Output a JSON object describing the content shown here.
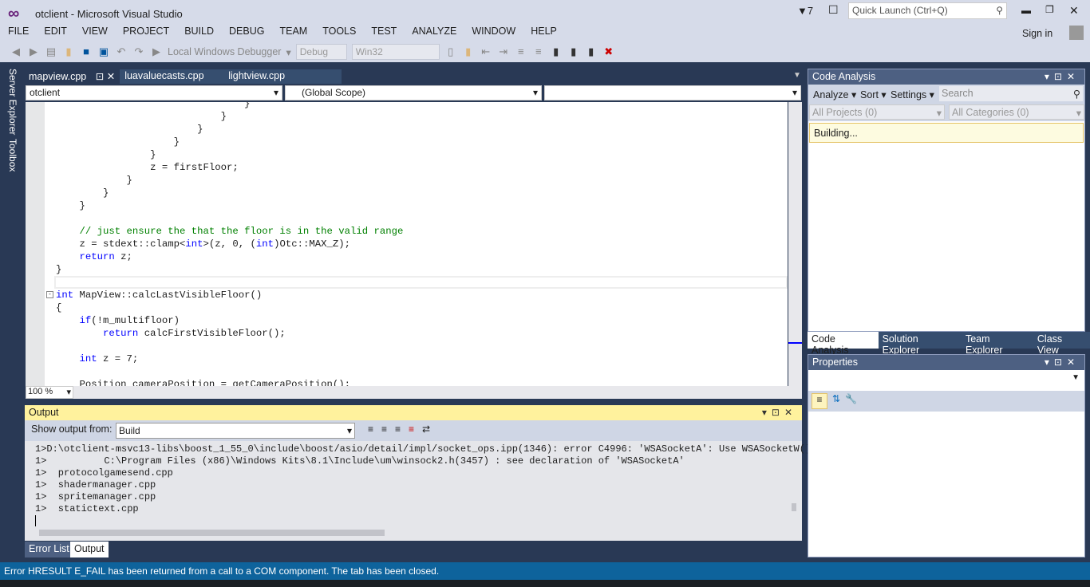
{
  "window": {
    "title": "otclient - Microsoft Visual Studio",
    "notifications": "7",
    "quick_launch_placeholder": "Quick Launch (Ctrl+Q)",
    "sign_in": "Sign in"
  },
  "menu": [
    "FILE",
    "EDIT",
    "VIEW",
    "PROJECT",
    "BUILD",
    "DEBUG",
    "TEAM",
    "TOOLS",
    "TEST",
    "ANALYZE",
    "WINDOW",
    "HELP"
  ],
  "toolbar": {
    "debugger": "Local Windows Debugger",
    "config": "Debug",
    "platform": "Win32"
  },
  "side_tabs": [
    "Server Explorer",
    "Toolbox"
  ],
  "doc_tabs": [
    "mapview.cpp",
    "luavaluecasts.cpp",
    "lightview.cpp"
  ],
  "nav": {
    "project": "otclient",
    "scope": "(Global Scope)",
    "member": ""
  },
  "zoom": "100 %",
  "code": [
    [
      [
        "",
        "                                }"
      ]
    ],
    [
      [
        "",
        "                            }"
      ]
    ],
    [
      [
        "",
        "                        }"
      ]
    ],
    [
      [
        "",
        "                    }"
      ]
    ],
    [
      [
        "",
        "                }"
      ]
    ],
    [
      [
        "",
        "                z = firstFloor;"
      ]
    ],
    [
      [
        "",
        "            }"
      ]
    ],
    [
      [
        "",
        "        }"
      ]
    ],
    [
      [
        "",
        "    }"
      ]
    ],
    [
      [
        "",
        ""
      ]
    ],
    [
      [
        "c",
        "    // just ensure the that the floor is in the valid range"
      ]
    ],
    [
      [
        "",
        "    z = stdext::clamp<"
      ],
      [
        "k",
        "int"
      ],
      [
        "",
        ">(z, 0, ("
      ],
      [
        "k",
        "int"
      ],
      [
        "",
        ")Otc::MAX_Z);"
      ]
    ],
    [
      [
        "k",
        "    return"
      ],
      [
        "",
        " z;"
      ]
    ],
    [
      [
        "",
        "}"
      ]
    ],
    [
      [
        "",
        ""
      ]
    ],
    [
      [
        "k",
        "int"
      ],
      [
        "",
        " MapView::calcLastVisibleFloor()"
      ]
    ],
    [
      [
        "",
        "{"
      ]
    ],
    [
      [
        "k",
        "    if"
      ],
      [
        "",
        "(!m_multifloor)"
      ]
    ],
    [
      [
        "k",
        "        return"
      ],
      [
        "",
        " calcFirstVisibleFloor();"
      ]
    ],
    [
      [
        "",
        ""
      ]
    ],
    [
      [
        "k",
        "    int"
      ],
      [
        "",
        " z = 7;"
      ]
    ],
    [
      [
        "",
        ""
      ]
    ],
    [
      [
        "",
        "    Position cameraPosition = getCameraPosition();"
      ]
    ]
  ],
  "code_analysis": {
    "title": "Code Analysis",
    "analyze": "Analyze",
    "sort": "Sort",
    "settings": "Settings",
    "search_placeholder": "Search",
    "projects": "All Projects (0)",
    "categories": "All Categories (0)",
    "status": "Building..."
  },
  "right_tabs": [
    "Code Analysis",
    "Solution Explorer",
    "Team Explorer",
    "Class View"
  ],
  "properties": {
    "title": "Properties"
  },
  "output": {
    "title": "Output",
    "show_from_label": "Show output from:",
    "source": "Build",
    "lines": [
      "1>D:\\otclient-msvc13-libs\\boost_1_55_0\\include\\boost/asio/detail/impl/socket_ops.ipp(1346): error C4996: 'WSASocketA': Use WSASocketW()",
      "1>          C:\\Program Files (x86)\\Windows Kits\\8.1\\Include\\um\\winsock2.h(3457) : see declaration of 'WSASocketA'",
      "1>  protocolgamesend.cpp",
      "1>  shadermanager.cpp",
      "1>  spritemanager.cpp",
      "1>  statictext.cpp"
    ]
  },
  "bottom_tabs": [
    "Error List",
    "Output"
  ],
  "status": "Error HRESULT E_FAIL has been returned from a call to a COM component.  The tab has been closed.",
  "colors": {
    "accent": "#0e639c",
    "chrome": "#d6dbe9",
    "dark": "#293955",
    "tool_header": "#4d6082",
    "output_header": "#fff29d"
  }
}
